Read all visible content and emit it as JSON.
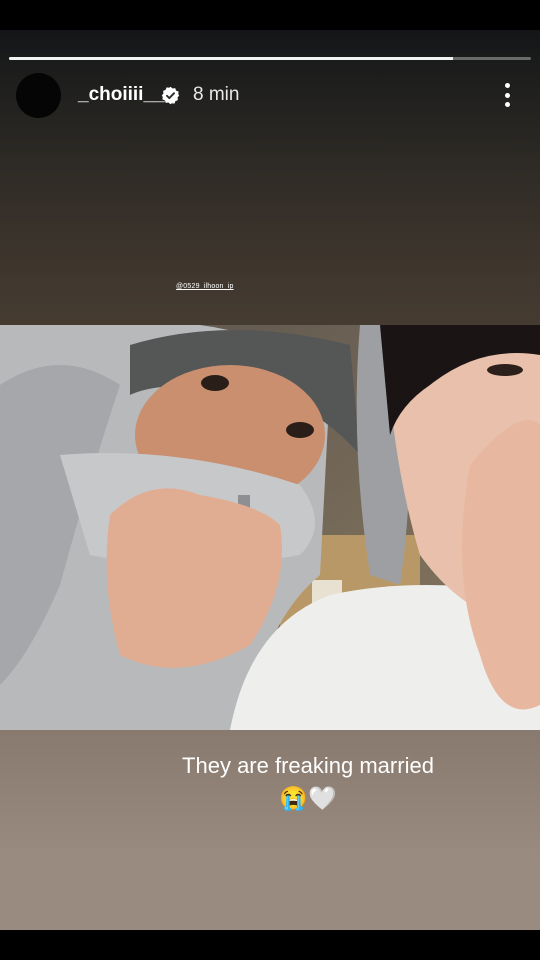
{
  "story": {
    "progress": 0.85,
    "username": "_choiiii__",
    "verified": true,
    "time_ago": "8 min",
    "watermark": "@0529_ilhoon_ip",
    "caption": "They are freaking married",
    "caption_emoji": "😭🤍"
  },
  "icons": {
    "verified": "verified-badge-icon",
    "menu": "more-options-icon"
  }
}
